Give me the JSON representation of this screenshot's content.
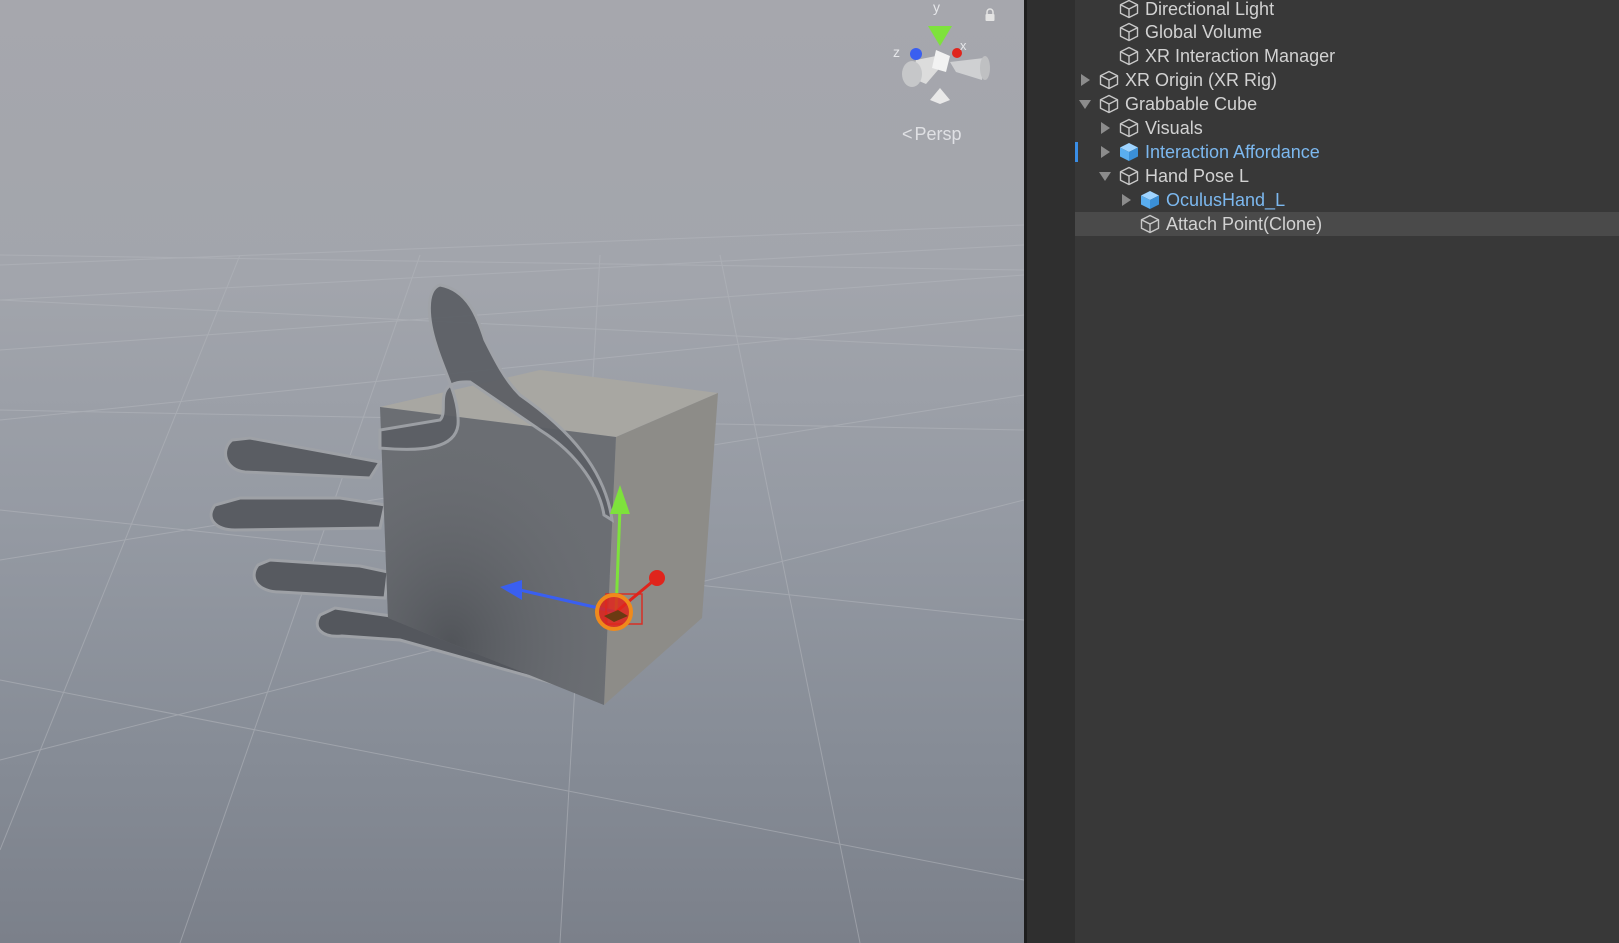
{
  "scene": {
    "projection_label": "Persp",
    "axis_labels": {
      "y": "y",
      "x": "x",
      "z": "z"
    },
    "colors": {
      "x_axis": "#e0241c",
      "y_axis": "#7ee23c",
      "z_axis": "#3a5ff0",
      "cube_face_front": "#6b6e73",
      "cube_face_side": "#8d8c88",
      "cube_face_top": "#a8a7a2",
      "hand": "#55585e"
    }
  },
  "hierarchy": {
    "items": [
      {
        "label": "Directional Light",
        "expand": "none",
        "prefab": false,
        "selected": false
      },
      {
        "label": "Global Volume",
        "expand": "none",
        "prefab": false,
        "selected": false
      },
      {
        "label": "XR Interaction Manager",
        "expand": "none",
        "prefab": false,
        "selected": false
      },
      {
        "label": "XR Origin (XR Rig)",
        "expand": "collapsed",
        "prefab": false,
        "selected": false
      },
      {
        "label": "Grabbable Cube",
        "expand": "expanded",
        "prefab": false,
        "selected": false
      },
      {
        "label": "Visuals",
        "expand": "collapsed",
        "prefab": false,
        "selected": false
      },
      {
        "label": "Interaction Affordance",
        "expand": "collapsed",
        "prefab": true,
        "selected": false
      },
      {
        "label": "Hand Pose L",
        "expand": "expanded",
        "prefab": false,
        "selected": false
      },
      {
        "label": "OculusHand_L",
        "expand": "collapsed",
        "prefab": true,
        "selected": false
      },
      {
        "label": "Attach Point(Clone)",
        "expand": "none",
        "prefab": false,
        "selected": true
      }
    ]
  }
}
